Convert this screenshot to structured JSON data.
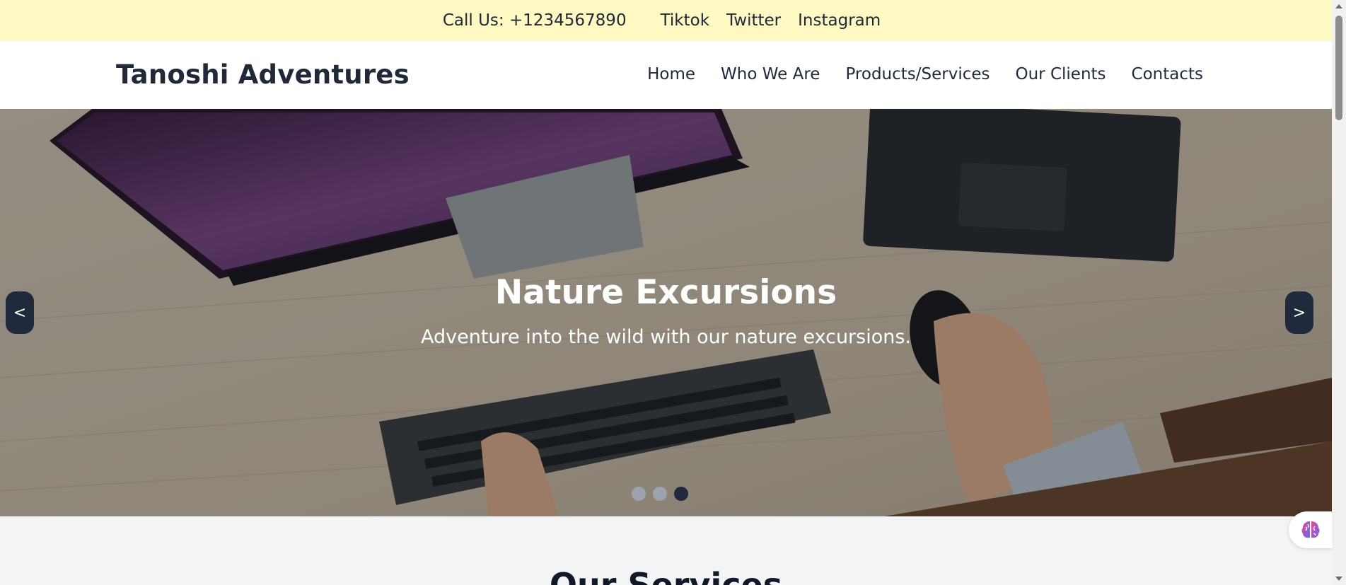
{
  "topbar": {
    "phone": "Call Us: +1234567890",
    "social": [
      "Tiktok",
      "Twitter",
      "Instagram"
    ]
  },
  "nav": {
    "brand": "Tanoshi Adventures",
    "links": [
      "Home",
      "Who We Are",
      "Products/Services",
      "Our Clients",
      "Contacts"
    ]
  },
  "hero": {
    "title": "Nature Excursions",
    "subtitle": "Adventure into the wild with our nature excursions.",
    "prev_label": "<",
    "next_label": ">",
    "slide_count": 3,
    "active_slide": 3
  },
  "services": {
    "heading": "Our Services"
  },
  "widget": {
    "icon": "brain-icon"
  },
  "colors": {
    "topbar_bg": "#fef9c3",
    "nav_bg": "#ffffff",
    "text": "#1f2937",
    "carousel_button": "#1f2a3c",
    "page_bg": "#f3f4f6"
  }
}
